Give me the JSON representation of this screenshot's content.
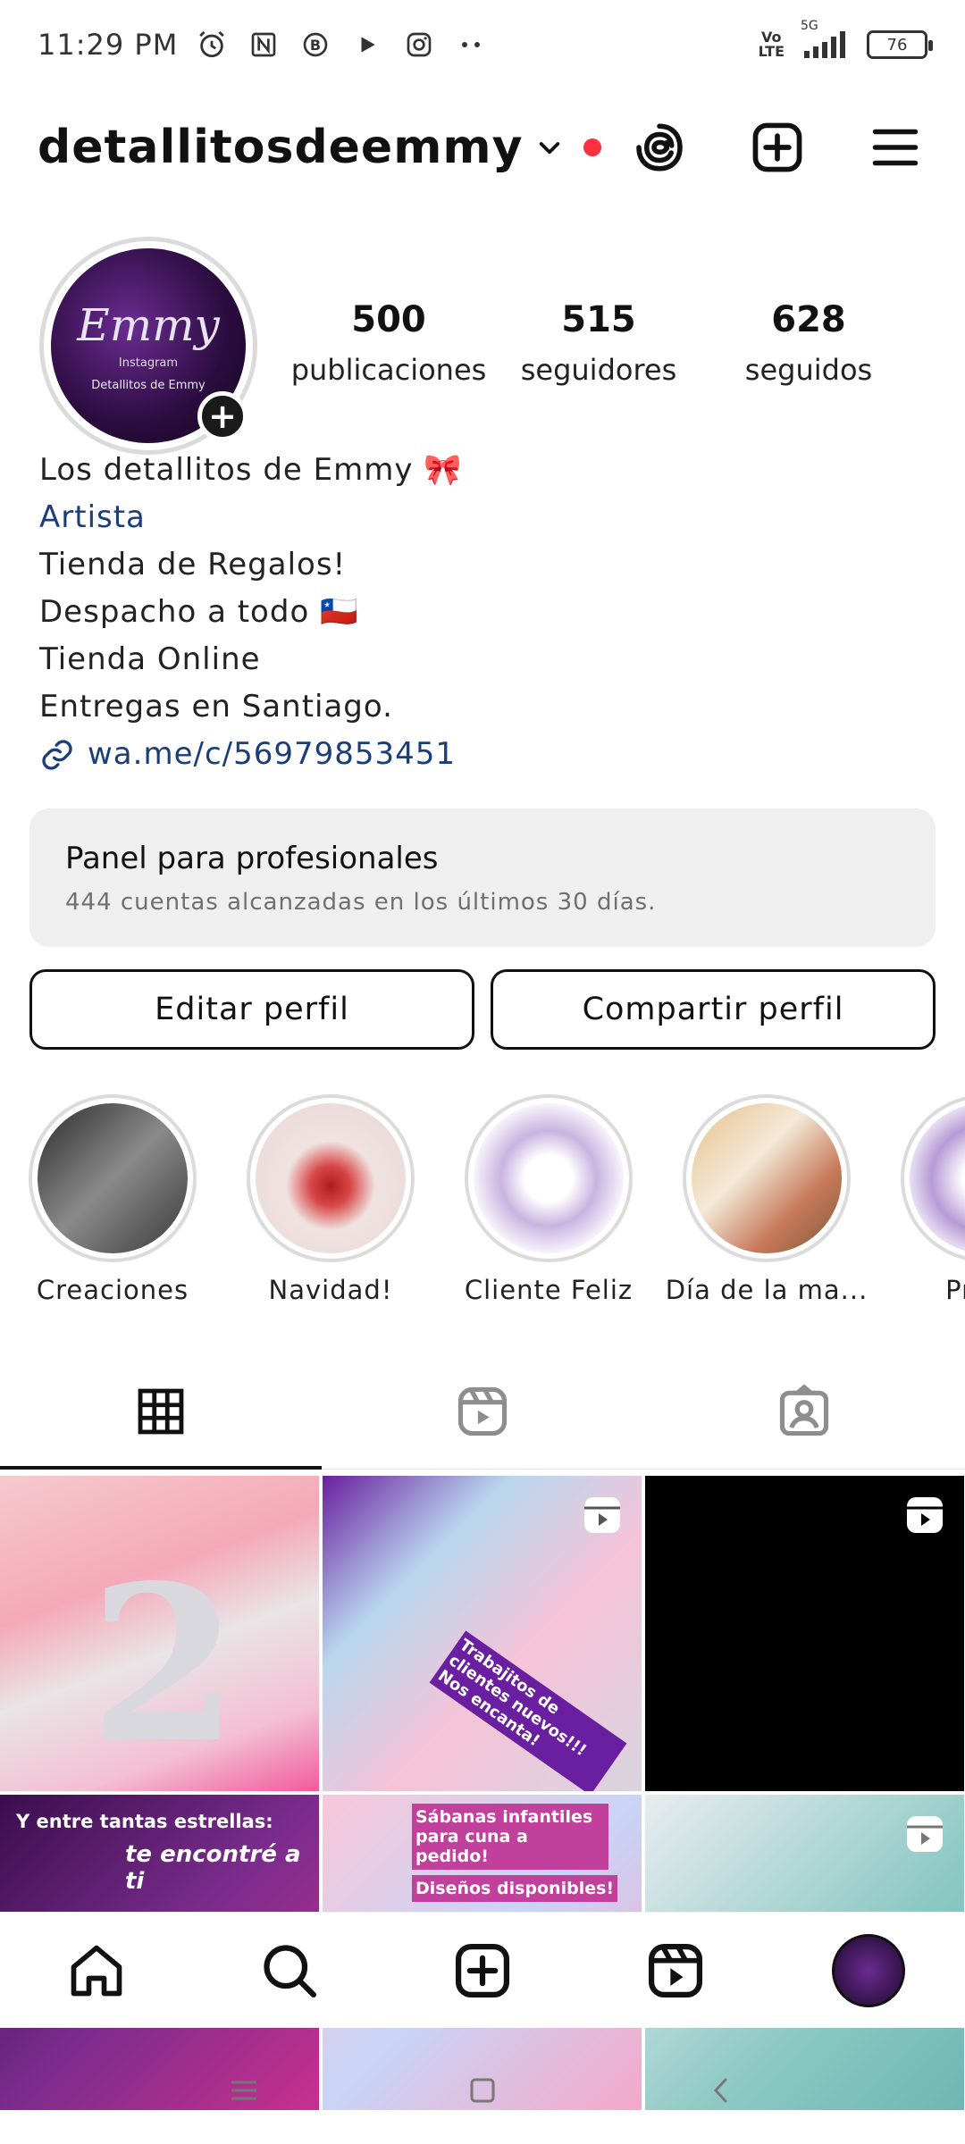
{
  "status_bar": {
    "time": "11:29 PM",
    "network_top": "Vo",
    "network_bottom": "LTE",
    "signal_label": "5G",
    "battery": "76"
  },
  "header": {
    "username": "detallitosdeemmy"
  },
  "profile": {
    "avatar_brand": "Emmy",
    "avatar_sub": "Instagram",
    "avatar_ig": "Detallitos de Emmy",
    "stats": [
      {
        "value": "500",
        "label": "publicaciones"
      },
      {
        "value": "515",
        "label": "seguidores"
      },
      {
        "value": "628",
        "label": "seguidos"
      }
    ]
  },
  "bio": {
    "name": "Los detallitos de Emmy 🎀",
    "category": "Artista",
    "lines": [
      "Tienda de Regalos!",
      "Despacho a todo 🇨🇱",
      "Tienda Online",
      "Entregas en Santiago."
    ],
    "link": "wa.me/c/56979853451"
  },
  "pro_panel": {
    "title": "Panel para profesionales",
    "subtitle": "444 cuentas alcanzadas en los últimos 30 días."
  },
  "buttons": {
    "edit": "Editar perfil",
    "share": "Compartir perfil"
  },
  "highlights": [
    {
      "label": "Creaciones",
      "color": "#5a5a5a"
    },
    {
      "label": "Navidad!",
      "color": "#e8d8d8"
    },
    {
      "label": "Cliente Feliz",
      "color": "#c9b3e0"
    },
    {
      "label": "Día de la ma...",
      "color": "#c77a5a"
    },
    {
      "label": "Produ",
      "color": "#b69ad6"
    }
  ],
  "grid": {
    "cell4_text": "Y entre tantas estrellas:",
    "cell4_text2": "te encontré a ti",
    "cell5_text": "Sábanas infantiles para cuna a pedido!",
    "cell5_text2": "Diseños disponibles!",
    "cell2_text": "Trabajitos de clientes nuevos!!! Nos encanta!"
  }
}
